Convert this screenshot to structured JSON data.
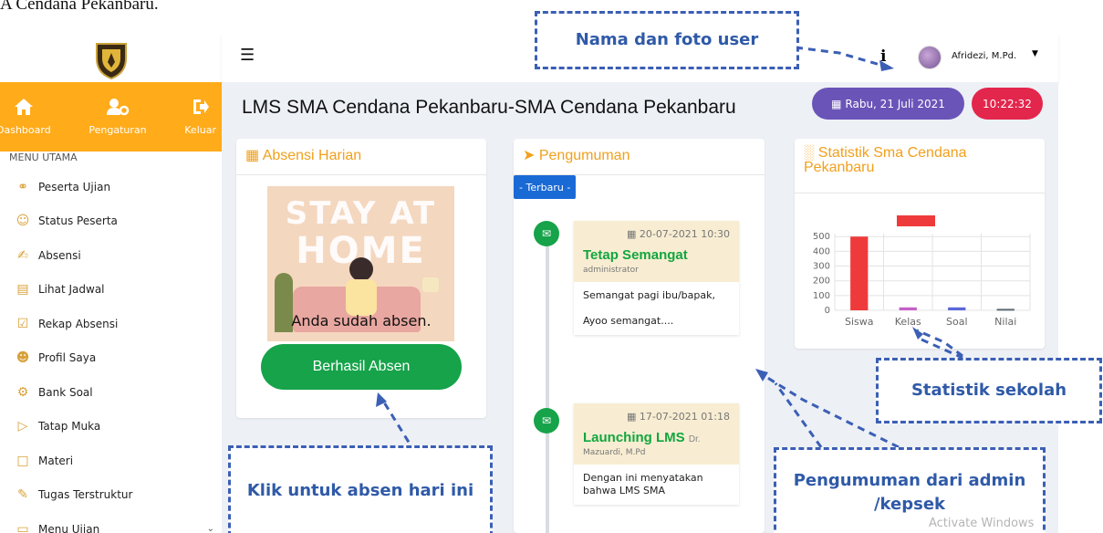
{
  "doc_fragment": "A Cendana Pekanbaru.",
  "sidebar": {
    "top_nav": [
      {
        "label": "Dashboard",
        "icon": "home-icon"
      },
      {
        "label": "Pengaturan",
        "icon": "user-gear-icon"
      },
      {
        "label": "Keluar",
        "icon": "logout-icon"
      }
    ],
    "menu_heading": "MENU UTAMA",
    "menu_items": [
      {
        "label": "Peserta Ujian",
        "icon": "users-icon"
      },
      {
        "label": "Status Peserta",
        "icon": "users-status-icon"
      },
      {
        "label": "Absensi",
        "icon": "absensi-icon"
      },
      {
        "label": "Lihat Jadwal",
        "icon": "calendar-icon"
      },
      {
        "label": "Rekap Absensi",
        "icon": "calendar-check-icon"
      },
      {
        "label": "Profil Saya",
        "icon": "profile-icon"
      },
      {
        "label": "Bank Soal",
        "icon": "bank-icon"
      },
      {
        "label": "Tatap Muka",
        "icon": "video-icon"
      },
      {
        "label": "Materi",
        "icon": "file-icon"
      },
      {
        "label": "Tugas Terstruktur",
        "icon": "edit-icon"
      },
      {
        "label": "Menu Ujian",
        "icon": "monitor-icon"
      }
    ]
  },
  "header": {
    "user_name": "Afridezi, M.Pd.",
    "info_label": "i"
  },
  "main": {
    "page_title": "LMS SMA Cendana Pekanbaru-SMA Cendana Pekanbaru",
    "date_pill": "Rabu, 21 Juli 2021",
    "time_pill": "10:22:32"
  },
  "absensi": {
    "title": "Absensi Harian",
    "image_text_1": "STAY AT",
    "image_text_2": "HOME",
    "message": "Anda sudah absen.",
    "button": "Berhasil Absen"
  },
  "pengumuman": {
    "title": "Pengumuman",
    "badge": "- Terbaru -",
    "items": [
      {
        "date": "20-07-2021 10:30",
        "title": "Tetap Semangat",
        "title_suffix": "",
        "author": "administrator",
        "body1": "Semangat pagi ibu/bapak,",
        "body2": "Ayoo semangat...."
      },
      {
        "date": "17-07-2021 01:18",
        "title": "Launching LMS",
        "title_suffix": "Dr.",
        "author": "Mazuardi, M.Pd",
        "body1": "Dengan ini menyatakan bahwa LMS SMA",
        "body2": ""
      }
    ]
  },
  "statistik": {
    "title": "Statistik Sma Cendana Pekanbaru"
  },
  "chart_data": {
    "type": "bar",
    "categories": [
      "Siswa",
      "Kelas",
      "Soal",
      "Nilai"
    ],
    "yticks": [
      0,
      100,
      200,
      300,
      400,
      500
    ],
    "ylim": [
      0,
      520
    ],
    "values": [
      500,
      20,
      20,
      10
    ],
    "bar_colors": [
      "#ee3a3a",
      "#c560c9",
      "#5b67d8",
      "#5a6a73"
    ],
    "legend_color": "#ee3a3a"
  },
  "annotations": {
    "user": "Nama dan foto user",
    "absen": "Klik untuk absen hari ini",
    "statistik": "Statistik sekolah",
    "pengumuman": "Pengumuman dari admin /kepsek"
  },
  "watermark": "Activate Windows"
}
